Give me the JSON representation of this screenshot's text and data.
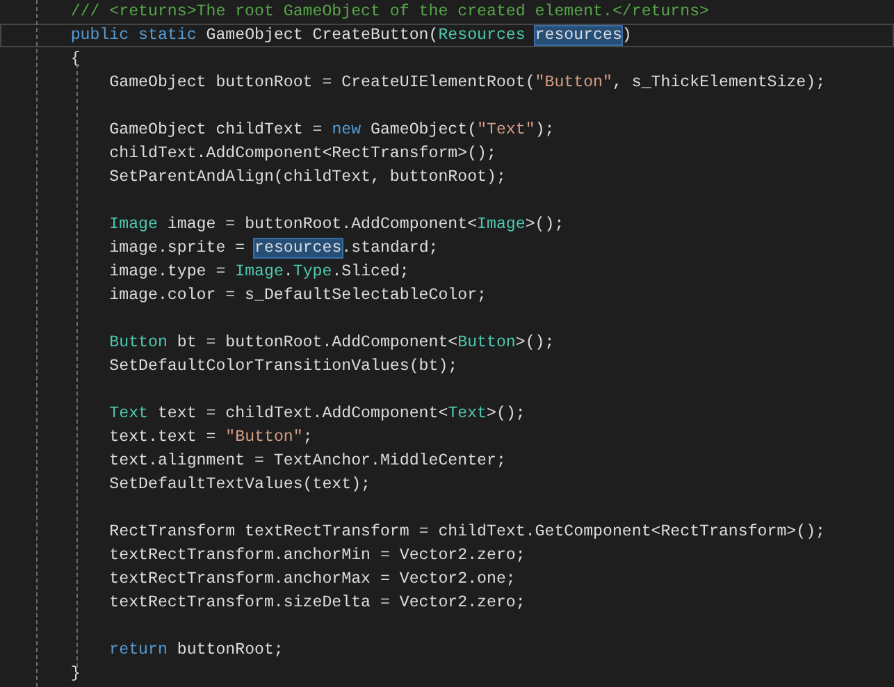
{
  "editor": {
    "lines": [
      {
        "kind": "code",
        "current": false,
        "tokens": [
          {
            "text": "    /// <returns>The root GameObject of the created element.</returns>",
            "kind": "comment"
          }
        ]
      },
      {
        "kind": "code",
        "current": true,
        "tokens": [
          {
            "text": "    public",
            "kind": "keyword"
          },
          {
            "text": " static",
            "kind": "keyword"
          },
          {
            "text": " GameObject CreateButton(",
            "kind": "plain"
          },
          {
            "text": "Resources ",
            "kind": "type"
          },
          {
            "text": "resources",
            "kind": "reference"
          },
          {
            "text": ")",
            "kind": "plain"
          }
        ]
      },
      {
        "kind": "code",
        "current": false,
        "tokens": [
          {
            "text": "    {",
            "kind": "plain"
          }
        ]
      },
      {
        "kind": "code",
        "current": false,
        "tokens": [
          {
            "text": "        GameObject buttonRoot = CreateUIElementRoot(",
            "kind": "plain"
          },
          {
            "text": "\"Button\"",
            "kind": "string"
          },
          {
            "text": ", s_ThickElementSize);",
            "kind": "plain"
          }
        ]
      },
      {
        "kind": "blank"
      },
      {
        "kind": "code",
        "current": false,
        "tokens": [
          {
            "text": "        GameObject childText = ",
            "kind": "plain"
          },
          {
            "text": "new",
            "kind": "keyword"
          },
          {
            "text": " GameObject(",
            "kind": "plain"
          },
          {
            "text": "\"Text\"",
            "kind": "string"
          },
          {
            "text": ");",
            "kind": "plain"
          }
        ]
      },
      {
        "kind": "code",
        "current": false,
        "tokens": [
          {
            "text": "        childText.AddComponent<RectTransform>();",
            "kind": "plain"
          }
        ]
      },
      {
        "kind": "code",
        "current": false,
        "tokens": [
          {
            "text": "        SetParentAndAlign(childText, buttonRoot);",
            "kind": "plain"
          }
        ]
      },
      {
        "kind": "blank"
      },
      {
        "kind": "code",
        "current": false,
        "tokens": [
          {
            "text": "        Image",
            "kind": "type"
          },
          {
            "text": " image = buttonRoot.AddComponent<",
            "kind": "plain"
          },
          {
            "text": "Image",
            "kind": "type"
          },
          {
            "text": ">();",
            "kind": "plain"
          }
        ]
      },
      {
        "kind": "code",
        "current": false,
        "tokens": [
          {
            "text": "        image.sprite = ",
            "kind": "plain"
          },
          {
            "text": "resources",
            "kind": "reference"
          },
          {
            "text": ".standard;",
            "kind": "plain"
          }
        ]
      },
      {
        "kind": "code",
        "current": false,
        "tokens": [
          {
            "text": "        image.type = ",
            "kind": "plain"
          },
          {
            "text": "Image",
            "kind": "type"
          },
          {
            "text": ".",
            "kind": "plain"
          },
          {
            "text": "Type",
            "kind": "type"
          },
          {
            "text": ".Sliced;",
            "kind": "plain"
          }
        ]
      },
      {
        "kind": "code",
        "current": false,
        "tokens": [
          {
            "text": "        image.color = s_DefaultSelectableColor;",
            "kind": "plain"
          }
        ]
      },
      {
        "kind": "blank"
      },
      {
        "kind": "code",
        "current": false,
        "tokens": [
          {
            "text": "        Button",
            "kind": "type"
          },
          {
            "text": " bt = buttonRoot.AddComponent<",
            "kind": "plain"
          },
          {
            "text": "Button",
            "kind": "type"
          },
          {
            "text": ">();",
            "kind": "plain"
          }
        ]
      },
      {
        "kind": "code",
        "current": false,
        "tokens": [
          {
            "text": "        SetDefaultColorTransitionValues(bt);",
            "kind": "plain"
          }
        ]
      },
      {
        "kind": "blank"
      },
      {
        "kind": "code",
        "current": false,
        "tokens": [
          {
            "text": "        Text",
            "kind": "type"
          },
          {
            "text": " text = childText.AddComponent<",
            "kind": "plain"
          },
          {
            "text": "Text",
            "kind": "type"
          },
          {
            "text": ">();",
            "kind": "plain"
          }
        ]
      },
      {
        "kind": "code",
        "current": false,
        "tokens": [
          {
            "text": "        text.text = ",
            "kind": "plain"
          },
          {
            "text": "\"Button\"",
            "kind": "string"
          },
          {
            "text": ";",
            "kind": "plain"
          }
        ]
      },
      {
        "kind": "code",
        "current": false,
        "tokens": [
          {
            "text": "        text.alignment = TextAnchor.MiddleCenter;",
            "kind": "plain"
          }
        ]
      },
      {
        "kind": "code",
        "current": false,
        "tokens": [
          {
            "text": "        SetDefaultTextValues(text);",
            "kind": "plain"
          }
        ]
      },
      {
        "kind": "blank"
      },
      {
        "kind": "code",
        "current": false,
        "tokens": [
          {
            "text": "        RectTransform textRectTransform = childText.GetComponent<RectTransform>();",
            "kind": "plain"
          }
        ]
      },
      {
        "kind": "code",
        "current": false,
        "tokens": [
          {
            "text": "        textRectTransform.anchorMin = Vector2.zero;",
            "kind": "plain"
          }
        ]
      },
      {
        "kind": "code",
        "current": false,
        "tokens": [
          {
            "text": "        textRectTransform.anchorMax = Vector2.one;",
            "kind": "plain"
          }
        ]
      },
      {
        "kind": "code",
        "current": false,
        "tokens": [
          {
            "text": "        textRectTransform.sizeDelta = Vector2.zero;",
            "kind": "plain"
          }
        ]
      },
      {
        "kind": "blank"
      },
      {
        "kind": "code",
        "current": false,
        "tokens": [
          {
            "text": "        return",
            "kind": "keyword"
          },
          {
            "text": " buttonRoot;",
            "kind": "plain"
          }
        ]
      },
      {
        "kind": "code",
        "current": false,
        "tokens": [
          {
            "text": "    }",
            "kind": "plain"
          }
        ]
      }
    ]
  }
}
